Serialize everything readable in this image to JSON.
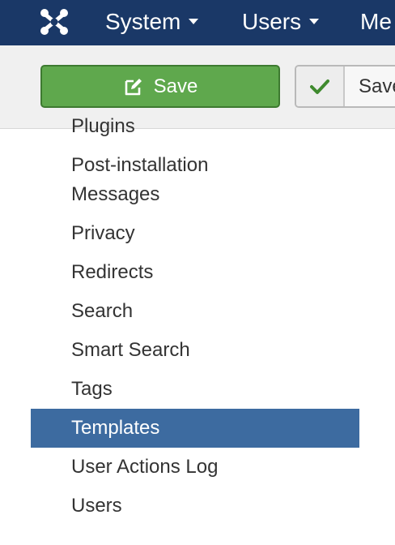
{
  "navbar": {
    "brand_icon": "joomla-logo-icon",
    "items": [
      {
        "label": "System",
        "has_caret": true
      },
      {
        "label": "Users",
        "has_caret": true
      },
      {
        "label": "Me"
      }
    ],
    "background": "#1a3867"
  },
  "toolbar": {
    "save_label": "Save",
    "save_icon": "edit-icon",
    "save_close_label": "Save",
    "save_close_icon": "check-icon",
    "save_color": "#5fa84d"
  },
  "menu": {
    "items": [
      {
        "label": "Plugins"
      },
      {
        "label": "Post-installation Messages"
      },
      {
        "label": "Privacy"
      },
      {
        "label": "Redirects"
      },
      {
        "label": "Search"
      },
      {
        "label": "Smart Search"
      },
      {
        "label": "Tags"
      },
      {
        "label": "Templates",
        "active": true
      },
      {
        "label": "User Actions Log"
      },
      {
        "label": "Users"
      }
    ],
    "active_color": "#3d6ba0"
  }
}
